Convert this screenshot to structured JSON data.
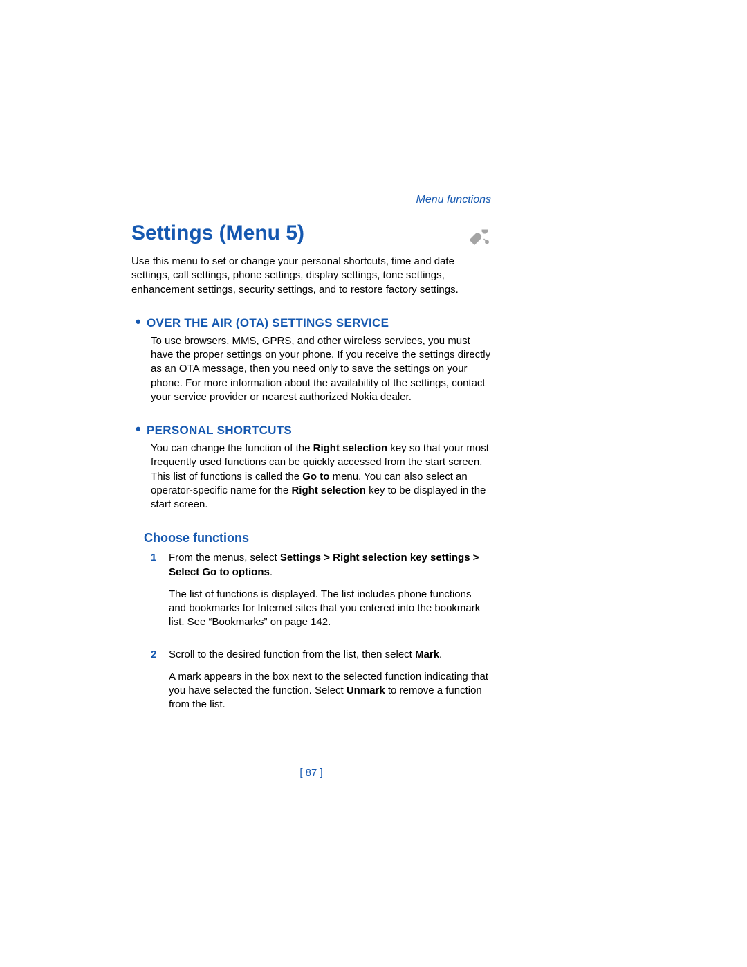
{
  "runningHeader": "Menu functions",
  "title": "Settings (Menu 5)",
  "intro": "Use this menu to set or change your personal shortcuts, time and date settings, call settings, phone settings, display settings, tone settings, enhancement settings, security settings, and to restore factory settings.",
  "sections": {
    "ota": {
      "heading": "OVER THE AIR (OTA) SETTINGS SERVICE",
      "body": "To use browsers, MMS, GPRS, and other wireless services, you must have the proper settings on your phone. If you receive the settings directly as an OTA message, then you need only to save the settings on your phone. For more information about the availability of the settings, contact your service provider or nearest authorized Nokia dealer."
    },
    "personal": {
      "heading": "PERSONAL SHORTCUTS",
      "body_pre": "You can change the function of the ",
      "body_bold1": "Right selection",
      "body_mid1": " key so that your most frequently used functions can be quickly accessed from the start screen. This list of functions is called the ",
      "body_bold2": "Go to",
      "body_mid2": " menu. You can also select an operator-specific name for the ",
      "body_bold3": "Right selection",
      "body_post": " key to be displayed in the start screen."
    }
  },
  "subheading": "Choose functions",
  "steps": {
    "s1": {
      "num": "1",
      "pre": "From the menus, select ",
      "bold": "Settings > Right selection key settings > Select Go to options",
      "post": ".",
      "extra": "The list of functions is displayed. The list includes phone functions and bookmarks for Internet sites that you entered into the bookmark list. See “Bookmarks” on page 142."
    },
    "s2": {
      "num": "2",
      "pre": "Scroll to the desired function from the list, then select ",
      "bold": "Mark",
      "post": ".",
      "extra_pre": "A mark appears in the box next to the selected function indicating that you have selected the function. Select ",
      "extra_bold": "Unmark",
      "extra_post": " to remove a function from the list."
    }
  },
  "pageNumber": "[ 87 ]"
}
